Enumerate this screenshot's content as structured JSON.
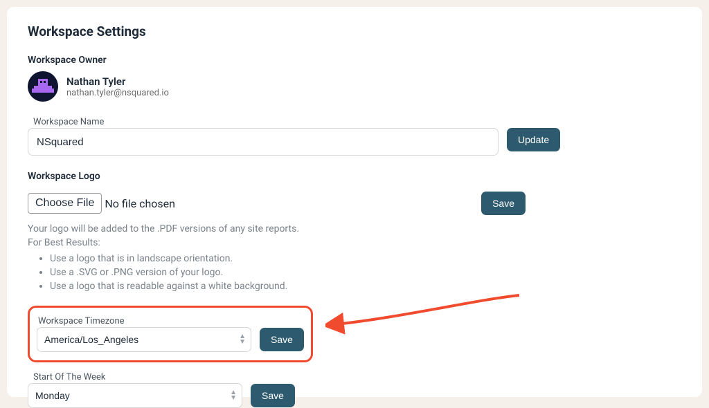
{
  "page_title": "Workspace Settings",
  "owner": {
    "section_label": "Workspace Owner",
    "name": "Nathan Tyler",
    "email": "nathan.tyler@nsquared.io"
  },
  "workspace_name": {
    "label": "Workspace Name",
    "value": "NSquared",
    "button": "Update"
  },
  "logo": {
    "section_label": "Workspace Logo",
    "choose_button": "Choose File",
    "file_status": "No file chosen",
    "save_button": "Save",
    "help_intro": "Your logo will be added to the .PDF versions of any site reports.",
    "help_heading": "For Best Results:",
    "help_items": [
      "Use a logo that is in landscape orientation.",
      "Use a .SVG or .PNG version of your logo.",
      "Use a logo that is readable against a white background."
    ]
  },
  "timezone": {
    "label": "Workspace Timezone",
    "value": "America/Los_Angeles",
    "save_button": "Save"
  },
  "start_of_week": {
    "label": "Start Of The Week",
    "value": "Monday",
    "save_button": "Save"
  }
}
